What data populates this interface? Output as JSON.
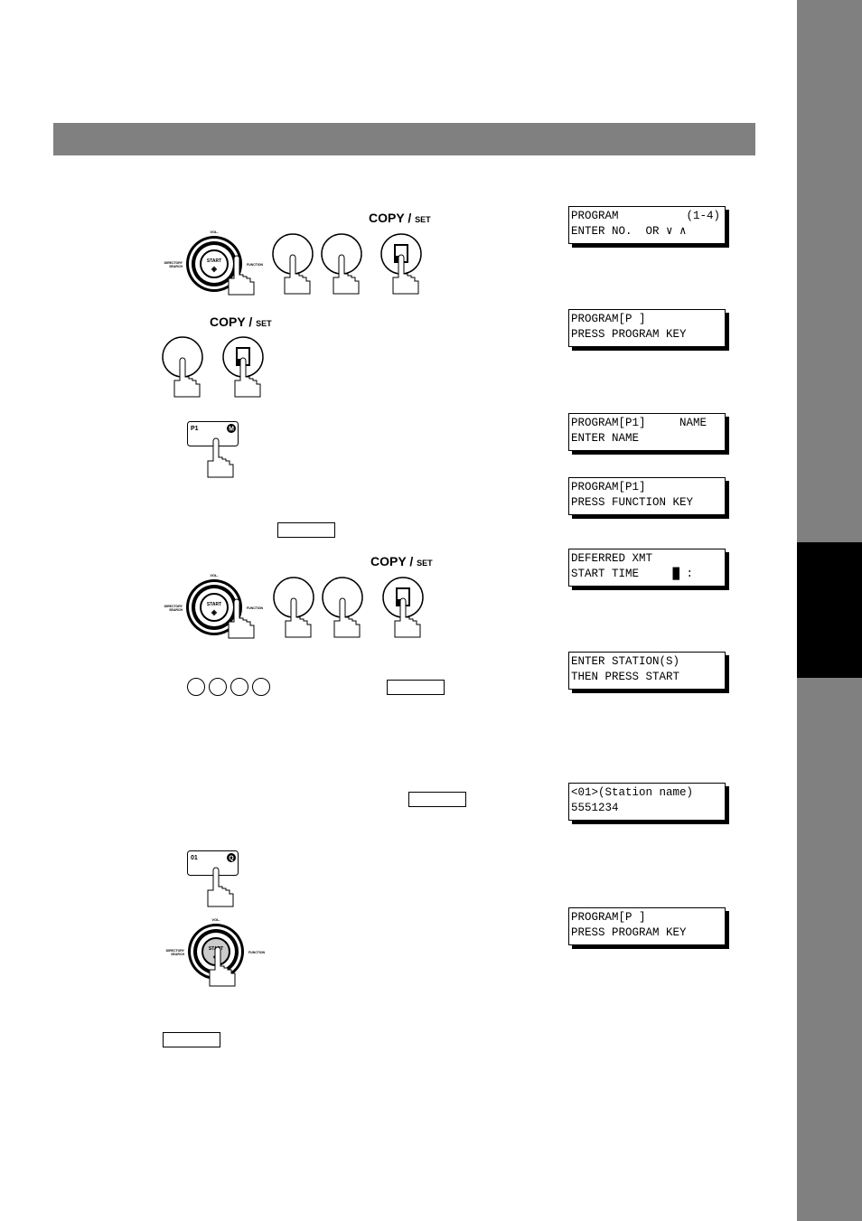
{
  "panel": {
    "vol": "VOL.",
    "start": "START",
    "directory": "DIRECTORY",
    "search": "SEARCH",
    "function": "FUNCTION"
  },
  "copy_set": {
    "copy": "COPY",
    "slash": "/",
    "set": "SET"
  },
  "keys": {
    "program_p1": "P1",
    "program_m": "M",
    "onetouch_01": "01",
    "onetouch_q": "Q"
  },
  "lcd": [
    [
      "PROGRAM          (1-4)",
      "ENTER NO.  OR ∨ ∧"
    ],
    [
      "PROGRAM[P ]",
      "PRESS PROGRAM KEY"
    ],
    [
      "PROGRAM[P1]     NAME",
      "ENTER NAME"
    ],
    [
      "PROGRAM[P1]",
      "PRESS FUNCTION KEY"
    ],
    [
      "DEFERRED XMT",
      "START TIME     █ :"
    ],
    [
      "ENTER STATION(S)",
      "THEN PRESS START"
    ],
    [
      "<01>(Station name)",
      "5551234"
    ],
    [
      "PROGRAM[P ]",
      "PRESS PROGRAM KEY"
    ]
  ]
}
